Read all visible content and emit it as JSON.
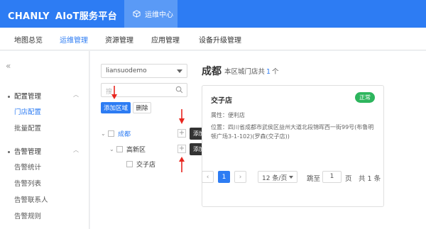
{
  "header": {
    "brand": "CHANLY",
    "platform": "AIoT服务平台",
    "ops_tab": "运维中心"
  },
  "nav": {
    "items": [
      "地图总览",
      "运维管理",
      "资源管理",
      "应用管理",
      "设备升级管理"
    ],
    "active_index": 1
  },
  "sidebar": {
    "collapse_glyph": "«",
    "group_config": "配置管理",
    "store_config": "门店配置",
    "batch_config": "批量配置",
    "group_alarm": "告警管理",
    "alarm_stats": "告警统计",
    "alarm_list": "告警列表",
    "alarm_contacts": "告警联系人",
    "alarm_rules": "告警规则"
  },
  "tree_panel": {
    "select_value": "liansuodemo",
    "search_placeholder": "搜",
    "add_region": "添加区域",
    "delete": "删除",
    "nodes": [
      {
        "label": "成都",
        "level": 0
      },
      {
        "label": "高新区",
        "level": 1
      },
      {
        "label": "交子店",
        "level": 2
      }
    ],
    "tooltip_add_group": "添加实例组",
    "tooltip_add_store": "添加门店"
  },
  "region": {
    "title": "成都",
    "summary_prefix": "本区城门店共",
    "count": "1",
    "summary_suffix": "个"
  },
  "store_card": {
    "name": "交子店",
    "status": "正常",
    "attr": "属性：便利店",
    "address": "位置：四川省成都市武侯区益州大道北段锦晖西一街99号(布鲁明顿广场3-1-102)(罗森(交子店))"
  },
  "pagination": {
    "prev": "‹",
    "current": "1",
    "next": "›",
    "page_size": "12 条/页",
    "goto_label": "跳至",
    "goto_value": "1",
    "page_unit": "页",
    "total": "共 1 条"
  },
  "colors": {
    "primary": "#2d7cf3",
    "success": "#2db55d",
    "annotation_arrow": "#e8261f"
  }
}
